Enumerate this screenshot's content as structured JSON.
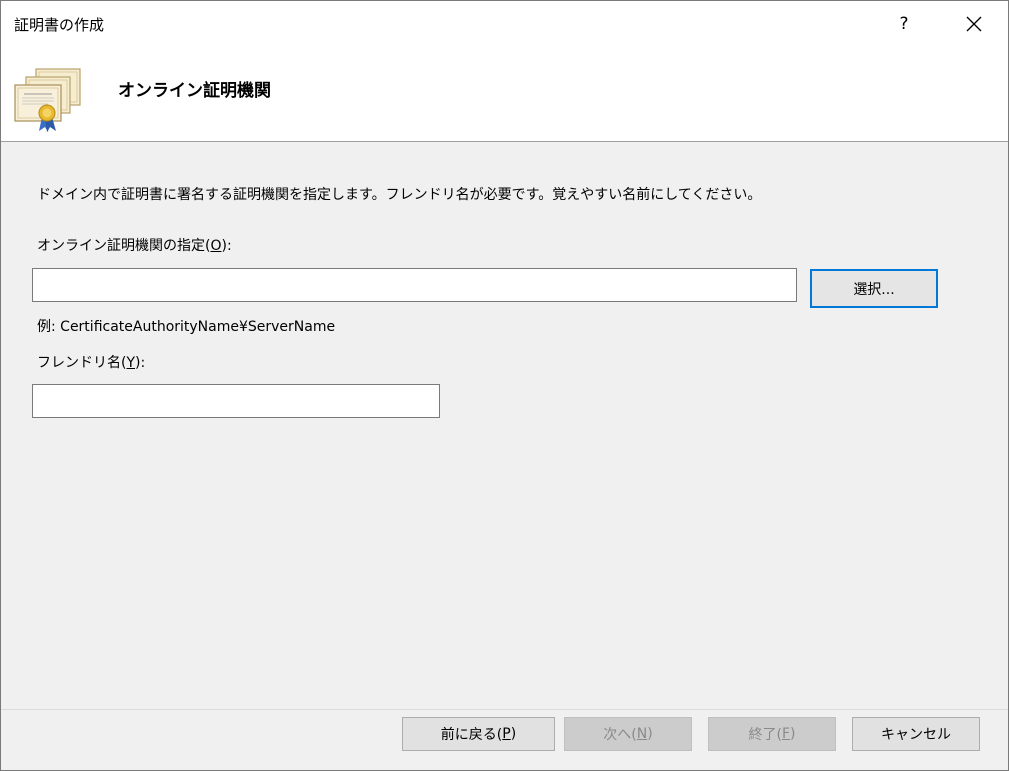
{
  "window": {
    "title": "証明書の作成",
    "help_label": "?"
  },
  "header": {
    "title": "オンライン証明機関",
    "icon": "certificate-icon"
  },
  "main": {
    "description": "ドメイン内で証明書に署名する証明機関を指定します。フレンドリ名が必要です。覚えやすい名前にしてください。",
    "ca_label_text": "オンライン証明機関の指定(",
    "ca_label_key": "O",
    "ca_label_suffix": "):",
    "ca_value": "",
    "select_button": "選択...",
    "example": "例: CertificateAuthorityName¥ServerName",
    "friendly_label_text": "フレンドリ名(",
    "friendly_label_key": "Y",
    "friendly_label_suffix": "):",
    "friendly_value": ""
  },
  "footer": {
    "back_text": "前に戻る(",
    "back_key": "P",
    "back_suffix": ")",
    "next_text": "次へ(",
    "next_key": "N",
    "next_suffix": ")",
    "finish_text": "終了(",
    "finish_key": "F",
    "finish_suffix": ")",
    "cancel": "キャンセル"
  },
  "colors": {
    "accent": "#0078d7",
    "background": "#f0f0f0",
    "header_bg": "#ffffff"
  }
}
